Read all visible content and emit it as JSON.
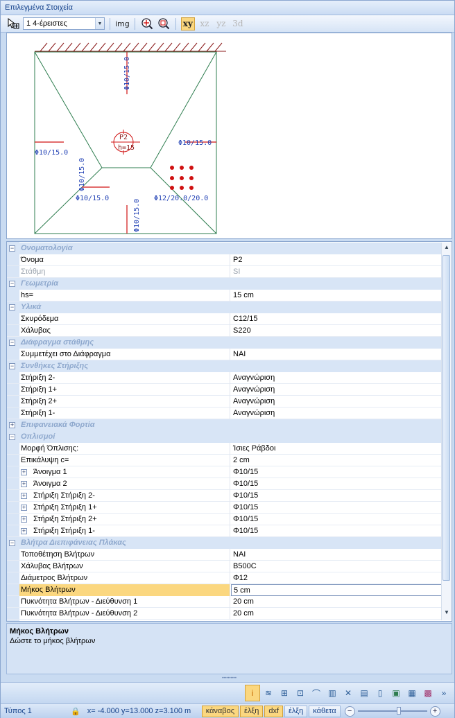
{
  "panel": {
    "title": "Επιλεγμένα Στοιχεία"
  },
  "toolbar": {
    "select_icon": "select-pointer-icon",
    "filter_value": "1 4-έρειστες",
    "img_label": "img",
    "zoom_in_icon": "zoom-in-icon",
    "zoom_out_icon": "zoom-out-icon",
    "view_xy": "xy",
    "view_xz": "xz",
    "view_yz": "yz",
    "view_3d": "3d"
  },
  "drawing": {
    "slab_name": "P2",
    "slab_thickness": "h=15",
    "rebar_top": "Φ10/15.0",
    "rebar_left": "Φ10/15.0",
    "rebar_right": "Φ10/15.0",
    "rebar_inner_left": "Φ10/15.0",
    "rebar_bottom_left": "Φ10/15.0",
    "rebar_bottom": "Φ10/15.0",
    "rebar_dowels": "Φ12/20.0/20.0",
    "colors": {
      "edge": "#2e7d4f",
      "rebar_text": "#1f3fb4",
      "rebar_line": "#d01010",
      "hatch": "#8b1a1a"
    }
  },
  "properties": {
    "cat_naming": "Ονοματολογία",
    "name_label": "Όνομα",
    "name_value": "P2",
    "level_label": "Στάθμη",
    "level_value": "SI",
    "cat_geometry": "Γεωμετρία",
    "hs_label": "hs=",
    "hs_value": "15 cm",
    "cat_materials": "Υλικά",
    "concrete_label": "Σκυρόδεμα",
    "concrete_value": "C12/15",
    "steel_label": "Χάλυβας",
    "steel_value": "S220",
    "cat_diaphragm": "Διάφραγμα στάθμης",
    "diaphragm_label": "Συμμετέχει στο Διάφραγμα",
    "diaphragm_value": "ΝΑΙ",
    "cat_supports": "Συνθήκες Στήριξης",
    "support_2m_label": "Στήριξη 2-",
    "support_2m_value": "Αναγνώριση",
    "support_1p_label": "Στήριξη 1+",
    "support_1p_value": "Αναγνώριση",
    "support_2p_label": "Στήριξη 2+",
    "support_2p_value": "Αναγνώριση",
    "support_1m_label": "Στήριξη 1-",
    "support_1m_value": "Αναγνώριση",
    "cat_loads": "Επιφανειακά Φορτία",
    "cat_reinforcement": "Οπλισμοί",
    "rf_form_label": "Μορφή Όπλισης:",
    "rf_form_value": "Ίσιες Ράβδοι",
    "cover_label": "Επικάλυψη c=",
    "cover_value": "2 cm",
    "span1_label": "Άνοιγμα 1",
    "span1_value": "Φ10/15",
    "span2_label": "Άνοιγμα 2",
    "span2_value": "Φ10/15",
    "sup_2m_label": "Στήριξη Στήριξη 2-",
    "sup_2m_value": "Φ10/15",
    "sup_1p_label": "Στήριξη Στήριξη 1+",
    "sup_1p_value": "Φ10/15",
    "sup_2p_label": "Στήριξη Στήριξη 2+",
    "sup_2p_value": "Φ10/15",
    "sup_1m_label": "Στήριξη Στήριξη 1-",
    "sup_1m_value": "Φ10/15",
    "cat_dowels": "Βλήτρα Διεπιφάνειας Πλάκας",
    "dowel_place_label": "Τοποθέτηση Βλήτρων",
    "dowel_place_value": "ΝΑΙ",
    "dowel_steel_label": "Χάλυβας Βλήτρων",
    "dowel_steel_value": "B500C",
    "dowel_diam_label": "Διάμετρος Βλήτρων",
    "dowel_diam_value": "Φ12",
    "dowel_len_label": "Μήκος Βλήτρων",
    "dowel_len_value": "5 cm",
    "dowel_d1_label": "Πυκνότητα Βλήτρων - Διεύθυνση 1",
    "dowel_d1_value": "20 cm",
    "dowel_d2_label": "Πυκνότητα Βλήτρων - Διεύθυνση 2",
    "dowel_d2_value": "20 cm"
  },
  "description": {
    "title": "Μήκος Βλήτρων",
    "text": "Δώστε το μήκος βλήτρων"
  },
  "statusbar": {
    "type_label": "Τύπος 1",
    "coords": "x= -4.000 y=13.000 z=3.100 m",
    "grid_btn": "κάναβος",
    "attract_btn": "έλξη",
    "dxf_btn": "dxf",
    "attract2_btn": "έλξη",
    "ortho_btn": "κάθετα"
  }
}
